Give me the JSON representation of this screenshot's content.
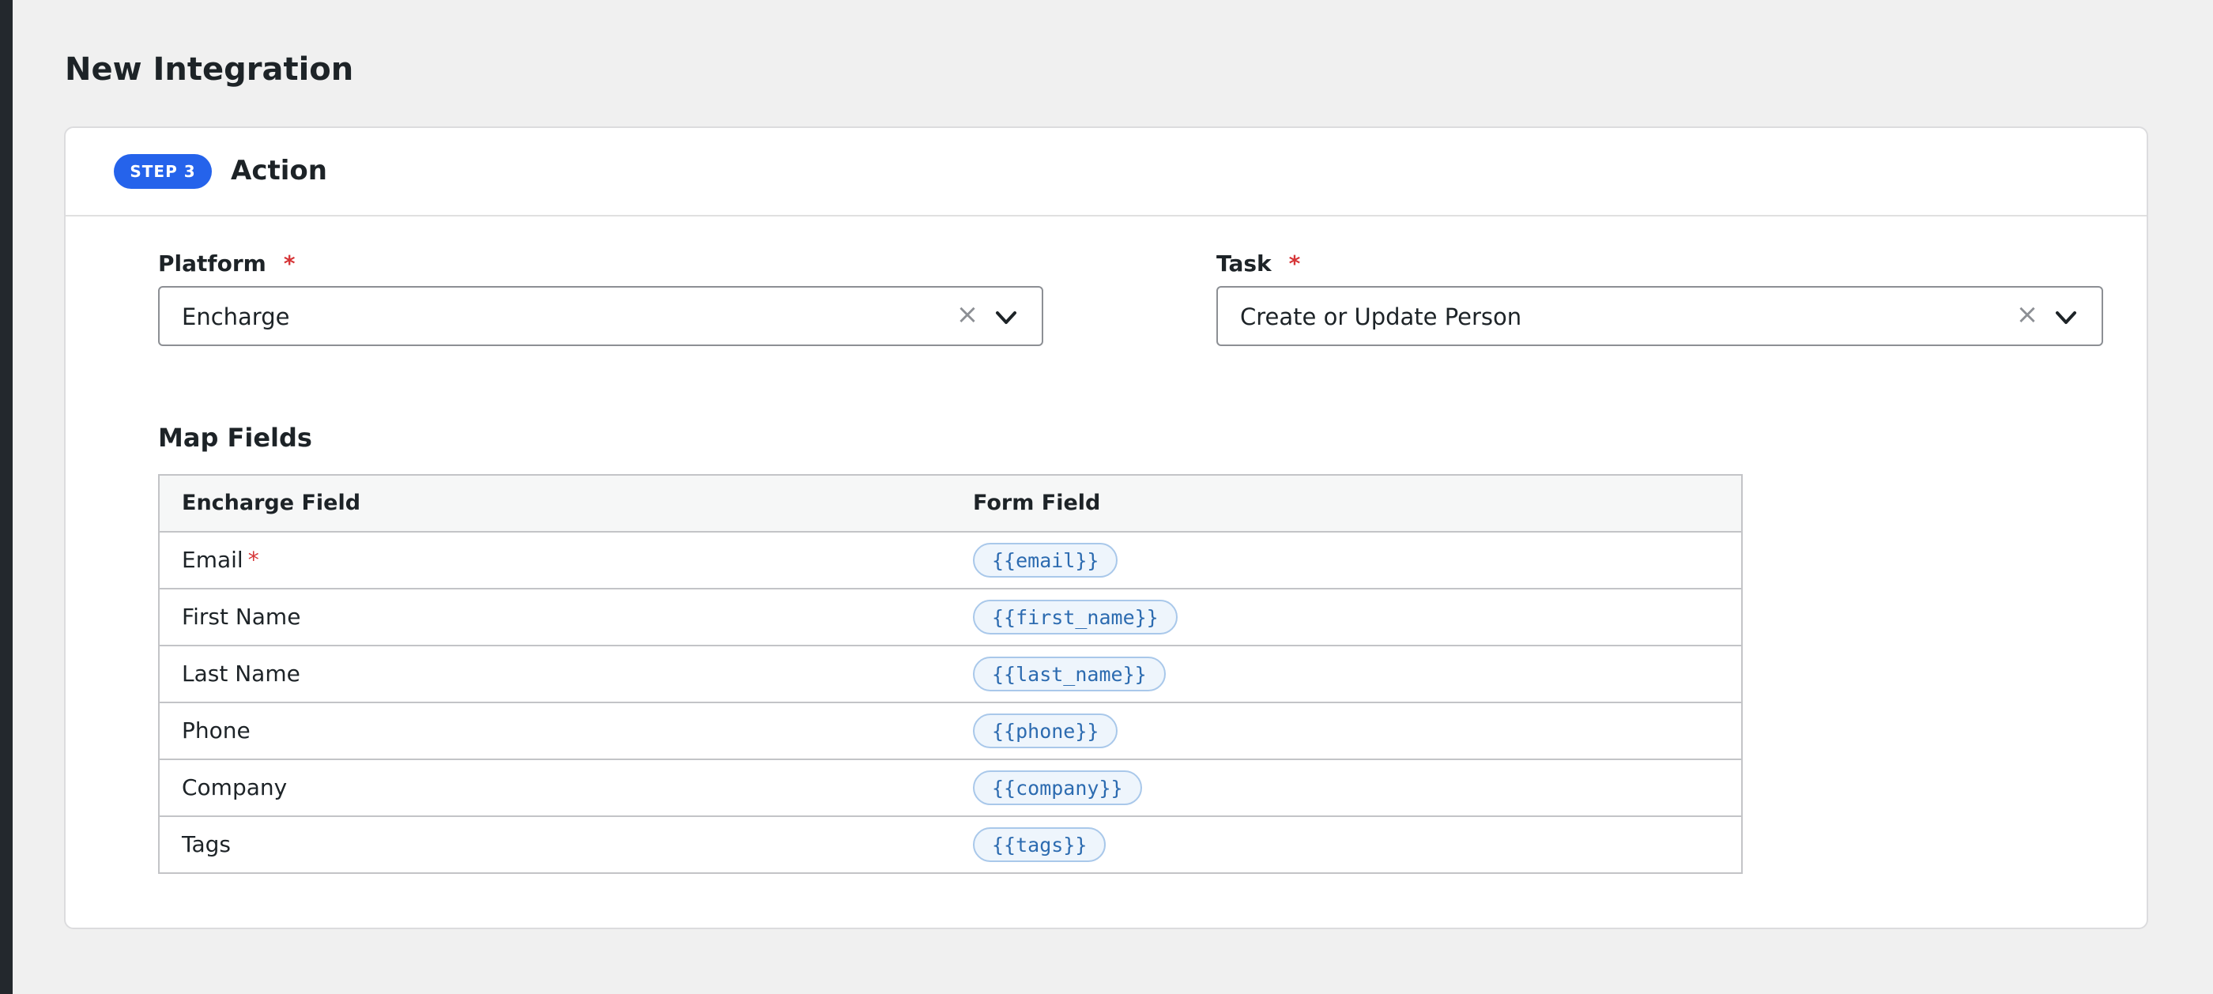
{
  "page": {
    "title": "New Integration"
  },
  "step": {
    "badge": "STEP 3",
    "title": "Action"
  },
  "platform": {
    "label": "Platform",
    "required_mark": "*",
    "value": "Encharge",
    "clear_symbol": "×",
    "icons": [
      "close-icon",
      "chevron-down-icon"
    ]
  },
  "task": {
    "label": "Task",
    "required_mark": "*",
    "value": "Create or Update Person",
    "clear_symbol": "×",
    "icons": [
      "close-icon",
      "chevron-down-icon"
    ]
  },
  "map_fields": {
    "title": "Map Fields",
    "headers": [
      "Encharge Field",
      "Form Field"
    ],
    "required_mark": "*",
    "rows": [
      {
        "field": "Email",
        "required": true,
        "token": "{{email}}"
      },
      {
        "field": "First Name",
        "required": false,
        "token": "{{first_name}}"
      },
      {
        "field": "Last Name",
        "required": false,
        "token": "{{last_name}}"
      },
      {
        "field": "Phone",
        "required": false,
        "token": "{{phone}}"
      },
      {
        "field": "Company",
        "required": false,
        "token": "{{company}}"
      },
      {
        "field": "Tags",
        "required": false,
        "token": "{{tags}}"
      }
    ]
  },
  "colors": {
    "badge": "#2563eb",
    "required": "#d63638",
    "token_text": "#2c6bb0",
    "token_bg": "#eef5fc",
    "token_border": "#a9c8ea",
    "page_bg": "#f0f0f0"
  }
}
